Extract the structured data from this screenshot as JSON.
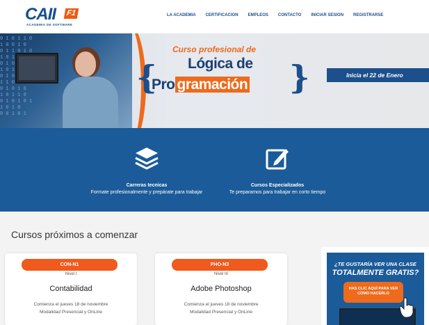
{
  "header": {
    "logo_text": "CAII",
    "logo_badge": "F1",
    "logo_tagline": "ACADEMIA DE SOFTWARE",
    "nav": [
      "LA ACADEMIA",
      "CERTIFICACION",
      "EMPLEOS",
      "CONTACTO",
      "INICIAR SESION",
      "REGISTRARSE"
    ]
  },
  "hero": {
    "subtitle": "Curso profesional de",
    "title_line1": "Lógica de",
    "title_prog_a": "Pro",
    "title_prog_b": "gramación",
    "brace_open": "{",
    "brace_close": "}",
    "ribbon": "Inicia el 22 de Enero",
    "code_overlay": "0 1 0 1 1 0\n1 0 0 1 0\n0 1 1 0 1 0\n1 0 1 0\n0 1 0 1 1\n1 0 1 0 0 1\n0 1 0 1\n1 1 0 0 1 0\n0 1 0 1 0\n1 0 1 1 0\n0 1 0 1 0 1\n1 0 1 0\n0 0 1 0 1"
  },
  "features": [
    {
      "icon": "layers-icon",
      "title": "Carreras tecnicas",
      "desc": "Formate profesionalmente y prepárate para trabajar"
    },
    {
      "icon": "edit-icon",
      "title": "Cursos Especializados",
      "desc": "Te preparamos para trabajar en corto tiempo"
    }
  ],
  "courses_section": {
    "title": "Cursos próximos a comenzar",
    "courses": [
      {
        "code": "CON-N1",
        "level": "Nivel I",
        "name": "Contabilidad",
        "date": "Comienza el jueves 18 de noviembre",
        "mode": "Modalidad Presencial y OnLine"
      },
      {
        "code": "PHO-N3",
        "level": "Nivel III",
        "name": "Adobe Photoshop",
        "date": "Comienza el jueves 18 de noviembre",
        "mode": "Modalidad Presencial y OnLine"
      }
    ]
  },
  "promo": {
    "question": "¿TE GUSTARÍA VER UNA CLASE",
    "headline": "TOTALMENTE GRATIS?",
    "button": "HAS CLIC AQUÍ PARA VER CÓMO HACERLO"
  },
  "colors": {
    "brand_blue": "#1b5b99",
    "brand_dark_blue": "#1c4f8c",
    "brand_orange": "#ee6a1c",
    "pill_orange": "#f05a1c"
  }
}
